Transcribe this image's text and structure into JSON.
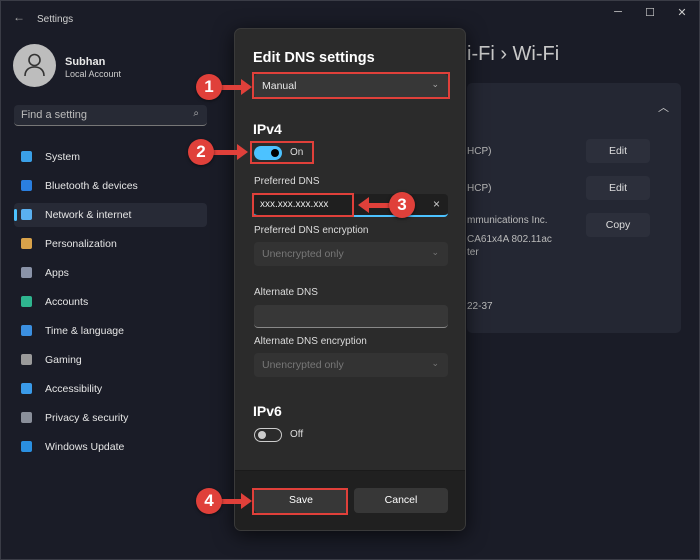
{
  "window": {
    "title": "Settings",
    "minimize": "─",
    "maximize": "☐",
    "close": "✕"
  },
  "user": {
    "name": "Subhan",
    "account": "Local Account"
  },
  "search": {
    "placeholder": "Find a setting"
  },
  "sidebar": {
    "items": [
      {
        "label": "System",
        "color": "#3aa0e8"
      },
      {
        "label": "Bluetooth & devices",
        "color": "#2a7fe0"
      },
      {
        "label": "Network & internet",
        "color": "#5ab0f0",
        "selected": true
      },
      {
        "label": "Personalization",
        "color": "#d9a24a"
      },
      {
        "label": "Apps",
        "color": "#8a93a8"
      },
      {
        "label": "Accounts",
        "color": "#2fb58f"
      },
      {
        "label": "Time & language",
        "color": "#3b8fe0"
      },
      {
        "label": "Gaming",
        "color": "#9a9a9a"
      },
      {
        "label": "Accessibility",
        "color": "#3a9ae8"
      },
      {
        "label": "Privacy & security",
        "color": "#8a8f9a"
      },
      {
        "label": "Windows Update",
        "color": "#2a8fe0"
      }
    ]
  },
  "main": {
    "breadcrumb": "i-Fi  ›  Wi-Fi",
    "rows": [
      "HCP)",
      "HCP)",
      "mmunications Inc.",
      "CA61x4A 802.11ac",
      "ter",
      "22-37"
    ],
    "buttons": [
      "Edit",
      "Edit",
      "Copy"
    ]
  },
  "dialog": {
    "title": "Edit DNS settings",
    "mode": "Manual",
    "ipv4": {
      "heading": "IPv4",
      "toggle": "On",
      "toggle_on": true,
      "preferred_label": "Preferred DNS",
      "preferred_value": "xxx.xxx.xxx.xxx",
      "preferred_enc_label": "Preferred DNS encryption",
      "preferred_enc_value": "Unencrypted only",
      "alternate_label": "Alternate DNS",
      "alternate_value": "",
      "alternate_enc_label": "Alternate DNS encryption",
      "alternate_enc_value": "Unencrypted only"
    },
    "ipv6": {
      "heading": "IPv6",
      "toggle": "Off",
      "toggle_on": false
    },
    "save": "Save",
    "cancel": "Cancel"
  },
  "annotations": [
    "1",
    "2",
    "3",
    "4"
  ],
  "colors": {
    "accent": "#4cc2ff",
    "annotation": "#e0403a"
  }
}
